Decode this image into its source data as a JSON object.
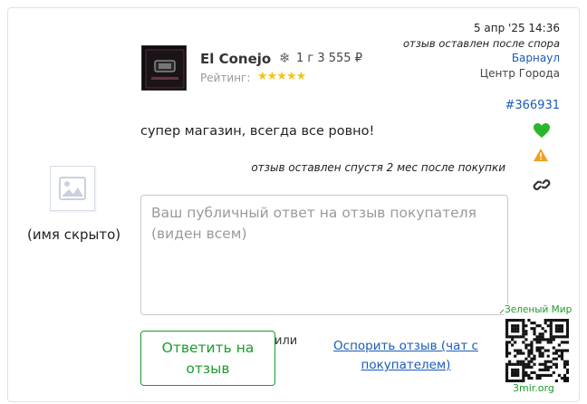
{
  "reviewer": {
    "name": "(имя скрыто)"
  },
  "product": {
    "name": "El Conejo",
    "icon": "snowflake-icon",
    "qty_price": "1 г 3 555 ₽",
    "rating_label": "Рейтинг:",
    "rating": 5,
    "stars": "★★★★★"
  },
  "meta": {
    "date": "5 апр '25 14:36",
    "after_dispute": "отзыв оставлен после спора",
    "city": "Барнаул",
    "district": "Центр Города",
    "review_id": "#366931"
  },
  "side_icons": [
    "green-heart-icon",
    "warning-icon",
    "link-icon"
  ],
  "colors": {
    "accent_green": "#1c9b2c",
    "link_blue": "#1a5bb8",
    "star_yellow": "#f5c518",
    "warning_orange": "#f0a020"
  },
  "review": {
    "text": "супер магазин, всегда все ровно!",
    "note": "отзыв оставлен спустя 2 мес после покупки"
  },
  "reply": {
    "placeholder": "Ваш публичный ответ на отзыв покупателя (виден всем)",
    "value": "",
    "button_label": "Ответить на отзыв",
    "or_text": "или",
    "dispute_link": "Оспорить отзыв (чат с покупателем)"
  },
  "watermark": {
    "top": "Зеленый Мир",
    "bottom": "3mir.org"
  }
}
